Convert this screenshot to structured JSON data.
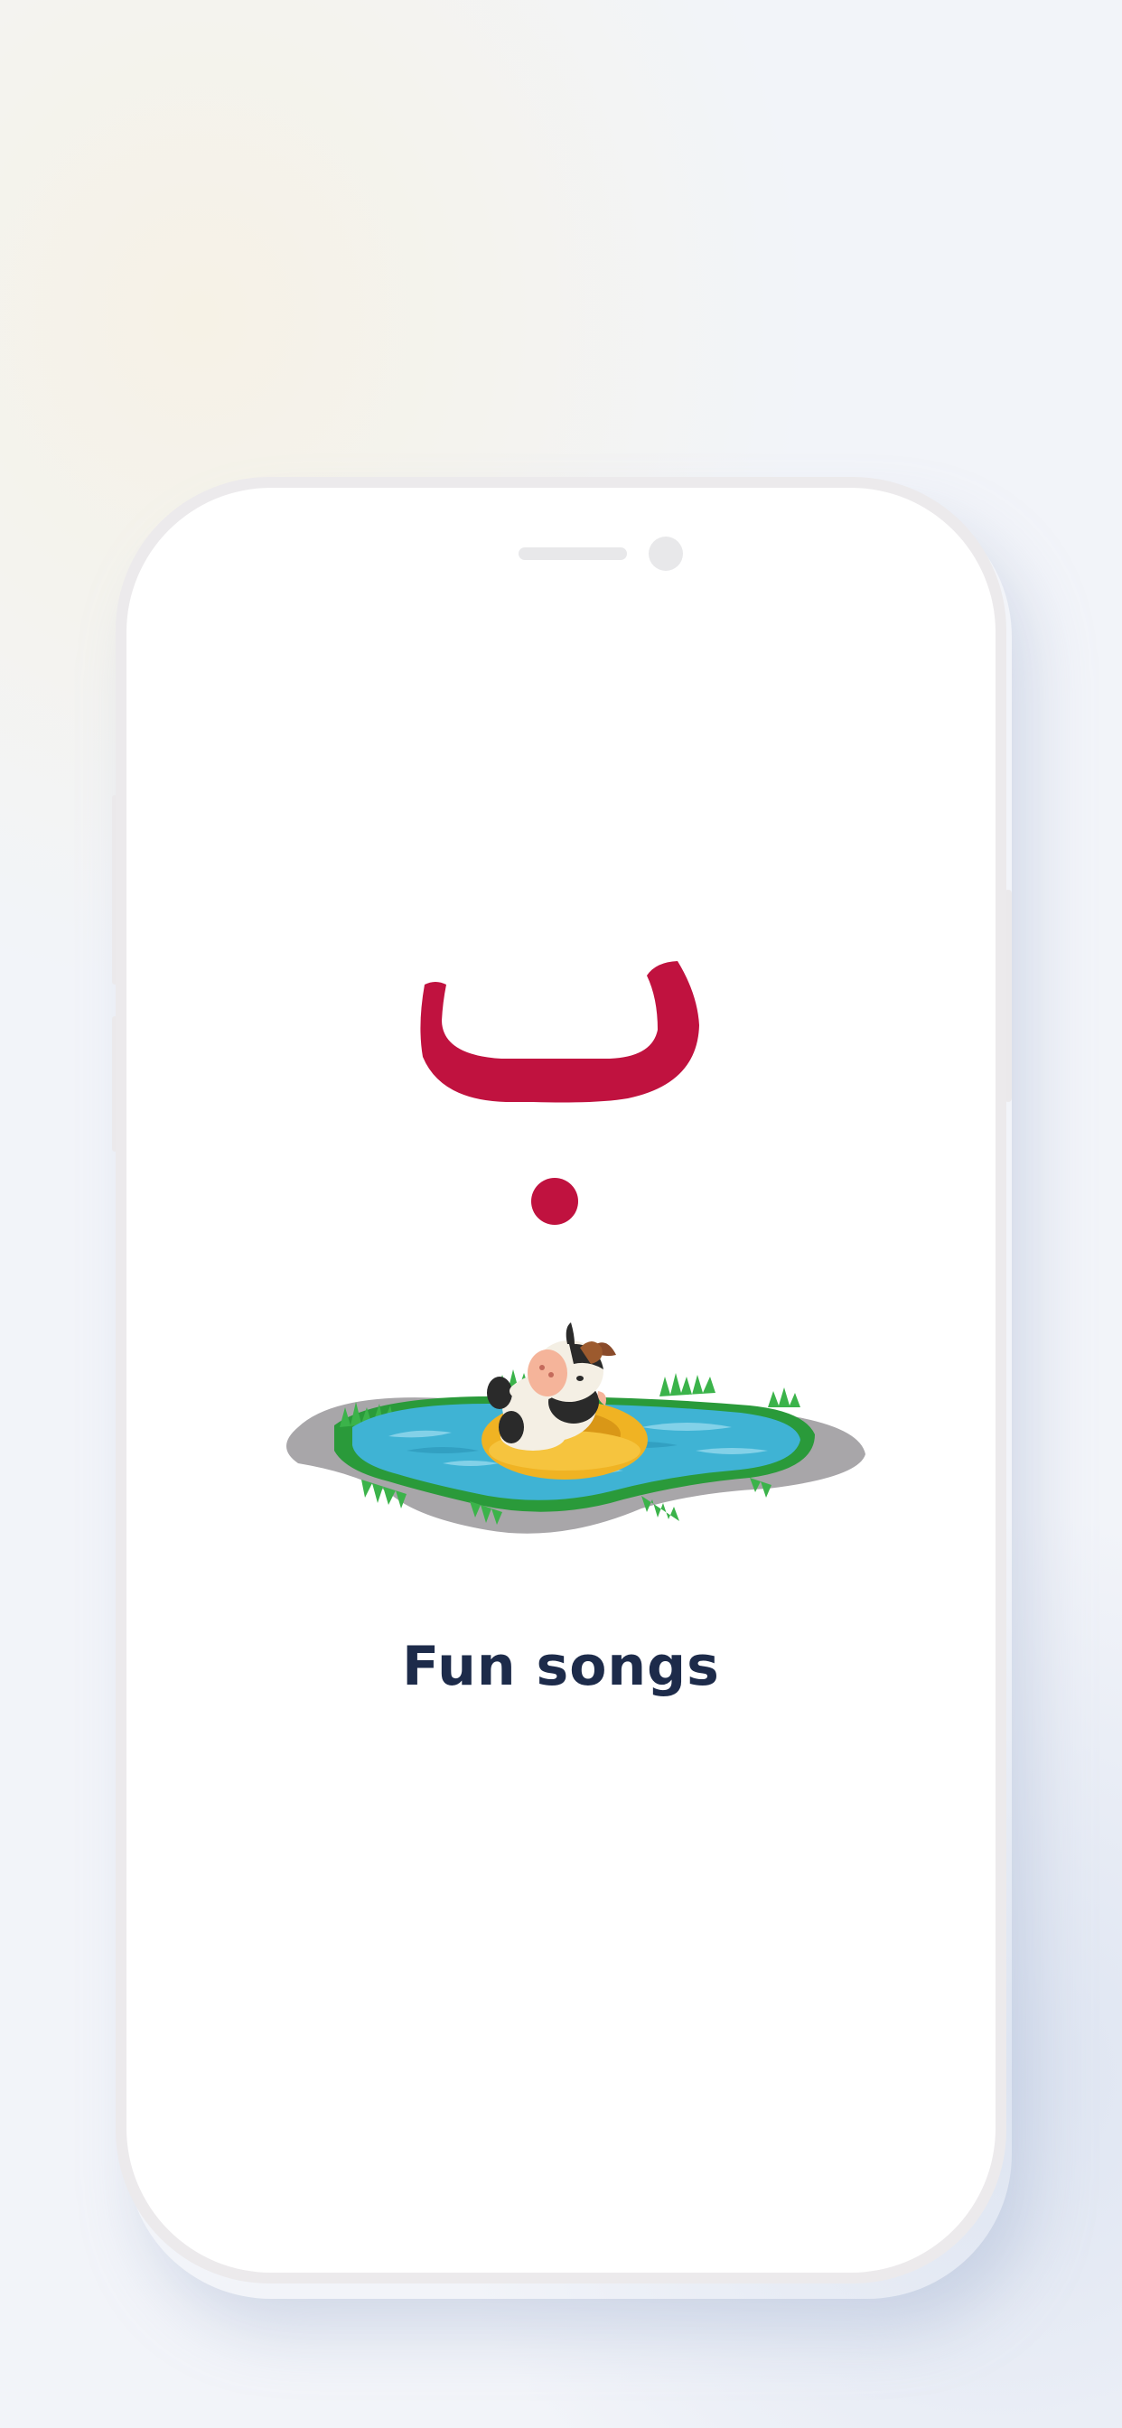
{
  "onboarding": {
    "letter_glyph": "ب",
    "caption": "Fun songs",
    "illustration": "cow-floating-in-pond"
  },
  "colors": {
    "letter": "#c0123f",
    "caption": "#1d2b4a",
    "background": "#f2f4f9",
    "phone_frame": "#eceaec"
  }
}
